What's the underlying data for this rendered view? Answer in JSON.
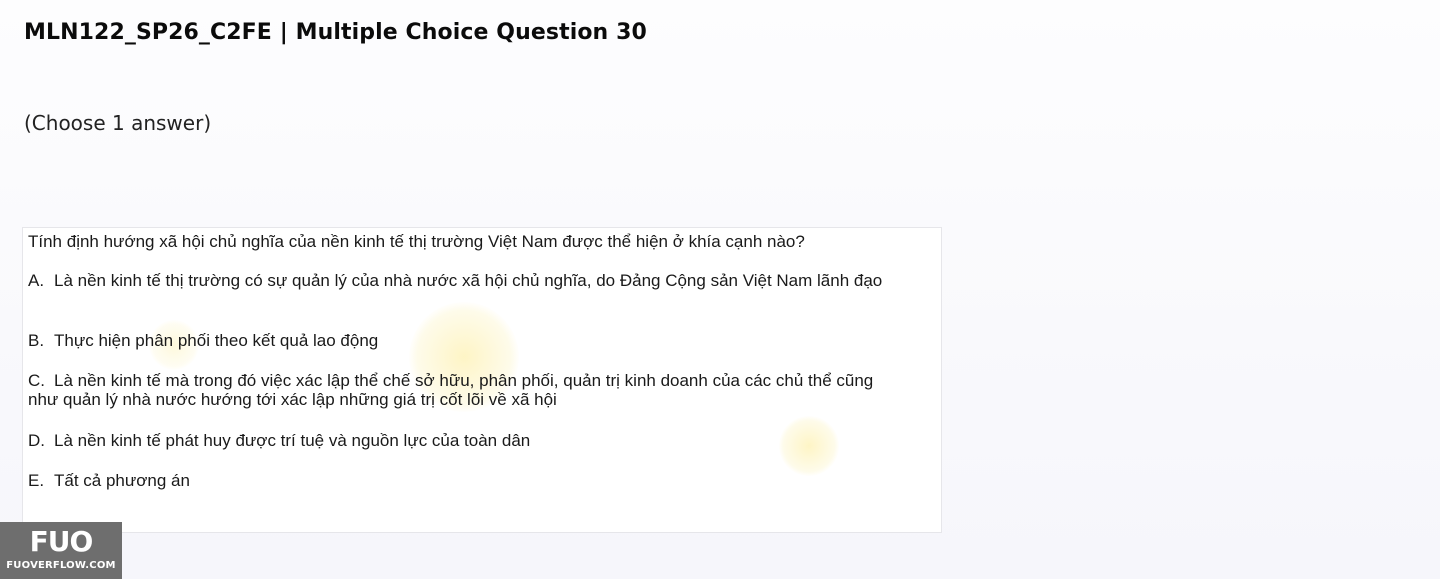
{
  "page": {
    "title": "MLN122_SP26_C2FE | Multiple Choice Question 30",
    "instruction": "(Choose 1 answer)"
  },
  "question": {
    "text": "Tính định hướng xã hội chủ nghĩa của nền kinh tế thị trường Việt Nam được thể hiện ở khía cạnh nào?",
    "options": [
      {
        "letter": "A.",
        "text": "Là nền kinh tế thị trường có sự quản lý của nhà nước xã hội chủ nghĩa, do Đảng Cộng sản Việt Nam lãnh đạo"
      },
      {
        "letter": "B.",
        "text": "Thực hiện phân phối theo kết quả lao động"
      },
      {
        "letter": "C.",
        "text": "Là nền kinh tế mà trong đó việc xác lập thể chế sở hữu, phân phối, quản trị kinh doanh của các chủ thể cũng như quản lý nhà nước hướng tới xác lập những giá trị cốt lõi về xã hội"
      },
      {
        "letter": "D.",
        "text": "Là nền kinh tế phát huy được trí tuệ và nguồn lực của toàn dân"
      },
      {
        "letter": "E.",
        "text": "Tất cả phương án"
      }
    ]
  },
  "watermark": {
    "logo_text": "FUO",
    "site_text": "FUOVERFLOW.COM"
  },
  "colors": {
    "background": "#f8f8fc",
    "card": "#ffffff",
    "logo_bg": "#6e6e6e"
  }
}
